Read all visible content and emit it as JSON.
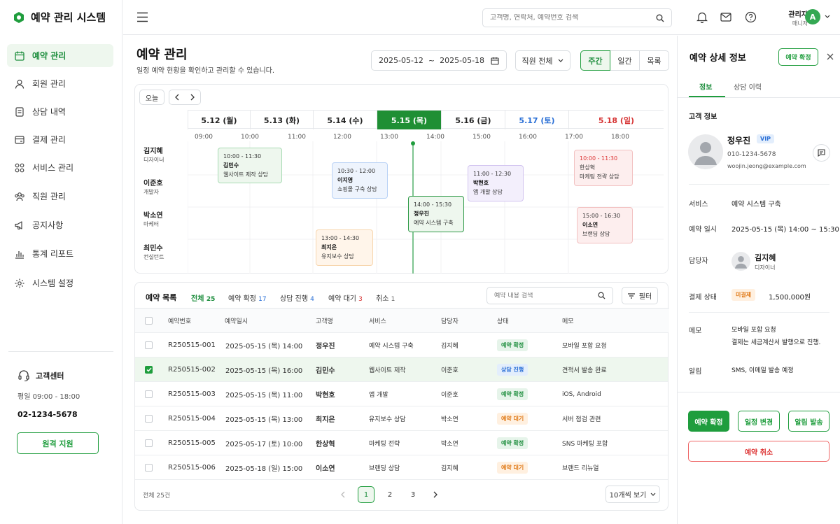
{
  "app": {
    "title": "예약 관리 시스템"
  },
  "sidebar": {
    "items": [
      {
        "label": "예약 관리",
        "icon": "calendar-icon",
        "active": true
      },
      {
        "label": "회원 관리",
        "icon": "user-icon"
      },
      {
        "label": "상담 내역",
        "icon": "document-icon"
      },
      {
        "label": "결제 관리",
        "icon": "wallet-icon"
      },
      {
        "label": "서비스 관리",
        "icon": "grid-icon"
      },
      {
        "label": "직원 관리",
        "icon": "team-icon"
      },
      {
        "label": "공지사항",
        "icon": "megaphone-icon"
      },
      {
        "label": "통계 리포트",
        "icon": "bar-chart-icon"
      },
      {
        "label": "시스템 설정",
        "icon": "gear-icon"
      }
    ],
    "support": {
      "title": "고객센터",
      "hours": "평일 09:00 - 18:00",
      "phone": "02-1234-5678",
      "button": "원격 지원"
    }
  },
  "topbar": {
    "search_placeholder": "고객명, 연락처, 예약번호 검색",
    "user_name": "관리자",
    "user_role": "매니저",
    "avatar_letter": "A"
  },
  "page": {
    "title": "예약 관리",
    "subtitle": "일정 예약 현황을 확인하고 관리할 수 있습니다.",
    "date_range": "2025-05-12  ~  2025-05-18",
    "staff_filter": "직원 전체",
    "views": [
      "주간",
      "일간",
      "목록"
    ]
  },
  "calendar": {
    "today_button": "오늘",
    "days": [
      {
        "label": "5.12 (월)",
        "color": "#222222"
      },
      {
        "label": "5.13 (화)",
        "color": "#222222"
      },
      {
        "label": "5.14 (수)",
        "color": "#222222"
      },
      {
        "label": "5.15 (목)",
        "color": "#ffffff",
        "selected": true
      },
      {
        "label": "5.16 (금)",
        "color": "#222222"
      },
      {
        "label": "5.17 (토)",
        "color": "#2a6fd6"
      },
      {
        "label": "5.18 (일)",
        "color": "#d63333"
      }
    ],
    "hours": [
      "09:00",
      "10:00",
      "11:00",
      "12:00",
      "13:00",
      "14:00",
      "15:00",
      "16:00",
      "17:00",
      "18:00"
    ],
    "staff": [
      {
        "name": "김지혜",
        "role": "디자이너"
      },
      {
        "name": "이준호",
        "role": "개발자"
      },
      {
        "name": "박소연",
        "role": "마케터"
      },
      {
        "name": "최민수",
        "role": "컨설턴트"
      }
    ],
    "events": [
      {
        "time": "10:00 - 11:30",
        "name": "김민수",
        "desc": "웹사이트 제작 상담"
      },
      {
        "time": "10:30 - 12:00",
        "name": "이지영",
        "desc": "쇼핑몰 구축 상담"
      },
      {
        "time": "14:00 - 15:30",
        "name": "정우진",
        "desc": "예약 시스템 구축"
      },
      {
        "time": "11:00 - 12:30",
        "name": "박현호",
        "desc": "앱 개발 상담"
      },
      {
        "time": "10:00 - 11:30",
        "name": "한상혁",
        "desc": "마케팅 전략 상담"
      },
      {
        "time": "15:00 - 16:30",
        "name": "이소연",
        "desc": "브랜딩 상담"
      },
      {
        "time": "13:00 - 14:30",
        "name": "최지은",
        "desc": "유지보수 상담"
      }
    ]
  },
  "list": {
    "title": "예약 목록",
    "tabs": [
      {
        "label": "전체",
        "count": "25"
      },
      {
        "label": "예약 확정",
        "count": "17"
      },
      {
        "label": "상담 진행",
        "count": "4"
      },
      {
        "label": "예약 대기",
        "count": "3"
      },
      {
        "label": "취소",
        "count": "1"
      }
    ],
    "search_placeholder": "예약 내용 검색",
    "filter_label": "필터",
    "columns": [
      "예약번호",
      "예약일시",
      "고객명",
      "서비스",
      "담당자",
      "상태",
      "메모"
    ],
    "rows": [
      {
        "id": "R250515-001",
        "datetime": "2025-05-15 (목) 14:00",
        "customer": "정우진",
        "service": "예약 시스템 구축",
        "staff": "김지혜",
        "status": "예약 확정",
        "memo": "모바일 포함 요청",
        "checked": false
      },
      {
        "id": "R250515-002",
        "datetime": "2025-05-15 (목) 16:00",
        "customer": "김민수",
        "service": "웹사이트 제작",
        "staff": "이준호",
        "status": "상담 진행",
        "memo": "견적서 발송 완료",
        "checked": true
      },
      {
        "id": "R250515-003",
        "datetime": "2025-05-15 (목) 11:00",
        "customer": "박현호",
        "service": "앱 개발",
        "staff": "이준호",
        "status": "예약 확정",
        "memo": "iOS, Android",
        "checked": false
      },
      {
        "id": "R250515-004",
        "datetime": "2025-05-15 (목) 13:00",
        "customer": "최지은",
        "service": "유지보수 상담",
        "staff": "박소연",
        "status": "예약 대기",
        "memo": "서버 점검 관련",
        "checked": false
      },
      {
        "id": "R250515-005",
        "datetime": "2025-05-17 (토) 10:00",
        "customer": "한상혁",
        "service": "마케팅 전략",
        "staff": "박소연",
        "status": "예약 확정",
        "memo": "SNS 마케팅 포함",
        "checked": false
      },
      {
        "id": "R250515-006",
        "datetime": "2025-05-18 (일) 15:00",
        "customer": "이소연",
        "service": "브랜딩 상담",
        "staff": "김지혜",
        "status": "예약 대기",
        "memo": "브랜드 리뉴얼",
        "checked": false
      }
    ],
    "total": "전체 25건",
    "pages": [
      "1",
      "2",
      "3"
    ],
    "page_size": "10개씩 보기"
  },
  "detail": {
    "title": "예약 상세 정보",
    "confirm_badge": "예약 확정",
    "tabs": [
      "정보",
      "상담 이력"
    ],
    "section_title": "고객 정보",
    "customer": {
      "name": "정우진",
      "tag": "VIP",
      "phone": "010-1234-5678",
      "email": "woojin.jeong@example.com"
    },
    "service_label": "서비스",
    "service": "예약 시스템 구축",
    "datetime_label": "예약 일시",
    "datetime": "2025-05-15 (목) 14:00 ~ 15:30",
    "staff_label": "담당자",
    "staff_name": "김지혜",
    "staff_role": "디자이너",
    "payment_label": "결제 상태",
    "payment_status": "미결제",
    "amount": "1,500,000원",
    "memo_label": "메모",
    "memo1": "모바일 포함 요청",
    "memo2": "결제는 세금계산서 발행으로 진행.",
    "alert_label": "알림",
    "alert": "SMS, 이메일 발송 예정",
    "buttons": {
      "confirm": "예약 확정",
      "reschedule": "일정 변경",
      "notify": "알림 발송",
      "cancel": "예약 취소"
    }
  }
}
